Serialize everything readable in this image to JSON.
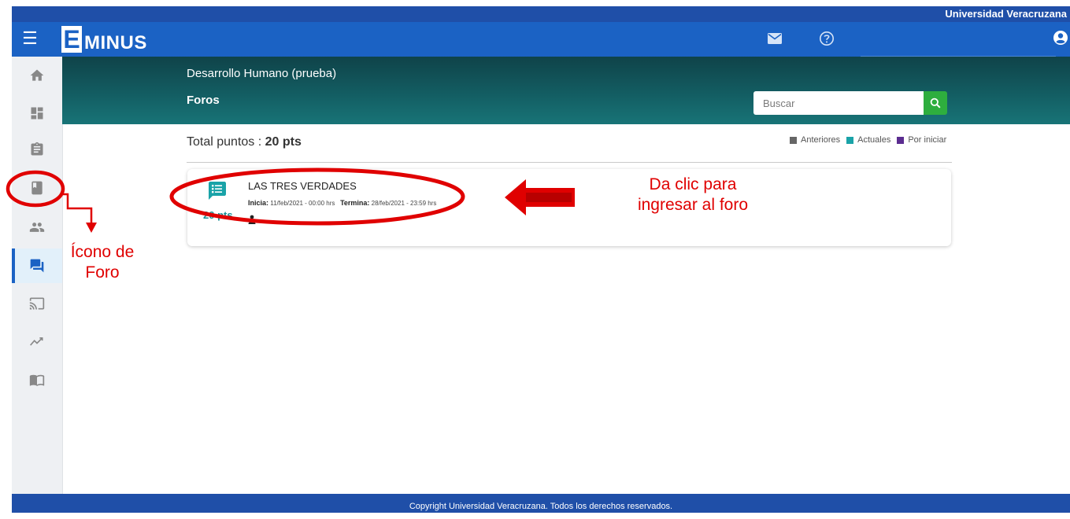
{
  "topbar": {
    "institution": "Universidad Veracruzana"
  },
  "navbar": {
    "logo_letter": "E",
    "logo_text": "MINUS",
    "icons": [
      "menu-icon",
      "mail-icon",
      "help-icon",
      "user-icon"
    ]
  },
  "sidebar": {
    "items": [
      {
        "icon": "home-icon",
        "active": false
      },
      {
        "icon": "dashboard-icon",
        "active": false
      },
      {
        "icon": "clipboard-icon",
        "active": false
      },
      {
        "icon": "book-icon",
        "active": false
      },
      {
        "icon": "people-icon",
        "active": false
      },
      {
        "icon": "forum-icon",
        "active": true
      },
      {
        "icon": "cast-icon",
        "active": false
      },
      {
        "icon": "trend-icon",
        "active": false
      },
      {
        "icon": "open-book-icon",
        "active": false
      }
    ]
  },
  "header": {
    "course": "Desarrollo Humano (prueba)",
    "section": "Foros",
    "search_placeholder": "Buscar"
  },
  "totals": {
    "label": "Total puntos : ",
    "value": "20 pts"
  },
  "legend": [
    {
      "label": "Anteriores",
      "color": "#666666"
    },
    {
      "label": "Actuales",
      "color": "#1aa3a8"
    },
    {
      "label": "Por iniciar",
      "color": "#5b2d90"
    }
  ],
  "forum": {
    "title": "LAS TRES VERDADES",
    "points": "20 pts",
    "start_label": "Inicia:",
    "start_value": "11/feb/2021 - 00:00 hrs",
    "end_label": "Termina:",
    "end_value": "28/feb/2021 - 23:59 hrs"
  },
  "annotations": {
    "forum_icon_line1": "Ícono de",
    "forum_icon_line2": "Foro",
    "click_line1": "Da clic para",
    "click_line2": "ingresar al foro"
  },
  "footer": {
    "copyright": "Copyright Universidad Veracruzana. Todos los derechos reservados."
  },
  "colors": {
    "navbar": "#1b62c4",
    "topstrip": "#1f4fa8",
    "header_band": "#135d62",
    "accent_teal": "#1a8f96",
    "search_button": "#2eae3e",
    "annotation_red": "#e00000"
  }
}
